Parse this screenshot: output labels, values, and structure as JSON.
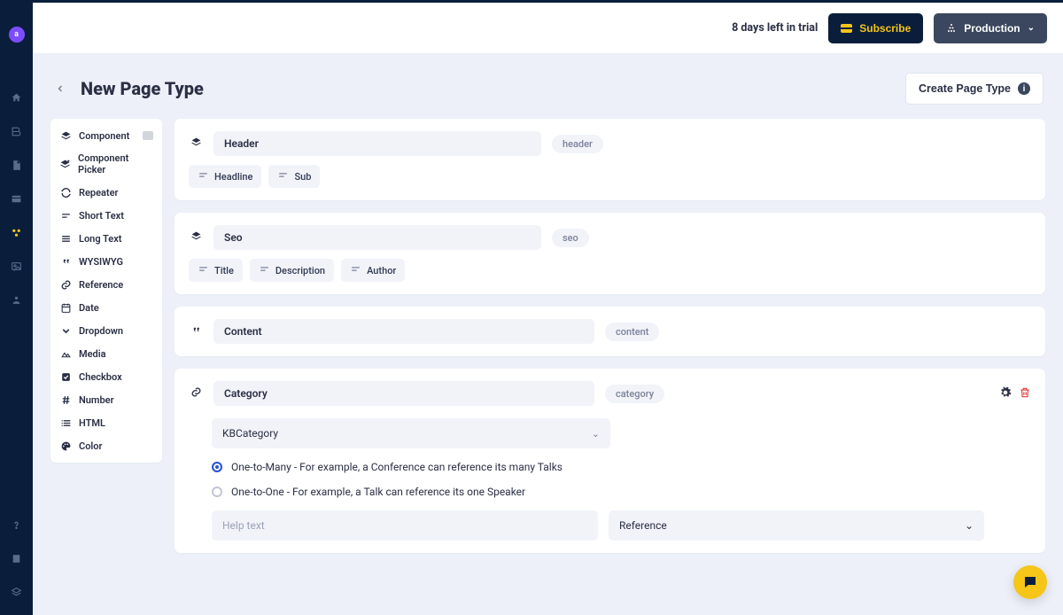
{
  "header": {
    "trial_text": "8 days left in trial",
    "subscribe_label": "Subscribe",
    "env_label": "Production"
  },
  "page": {
    "title": "New Page Type",
    "create_label": "Create Page Type"
  },
  "sidebar": {
    "avatar_letter": "a"
  },
  "palette": [
    {
      "icon": "layers",
      "label": "Component",
      "tail": true
    },
    {
      "icon": "layers-plus",
      "label": "Component Picker"
    },
    {
      "icon": "refresh",
      "label": "Repeater"
    },
    {
      "icon": "short",
      "label": "Short Text"
    },
    {
      "icon": "long",
      "label": "Long Text"
    },
    {
      "icon": "quote",
      "label": "WYSIWYG"
    },
    {
      "icon": "link",
      "label": "Reference"
    },
    {
      "icon": "date",
      "label": "Date"
    },
    {
      "icon": "chev",
      "label": "Dropdown"
    },
    {
      "icon": "media",
      "label": "Media"
    },
    {
      "icon": "check",
      "label": "Checkbox"
    },
    {
      "icon": "hash",
      "label": "Number"
    },
    {
      "icon": "list",
      "label": "HTML"
    },
    {
      "icon": "color",
      "label": "Color"
    }
  ],
  "components": [
    {
      "type": "component",
      "type_icon": "layers",
      "name": "Header",
      "slug": "header",
      "children": [
        {
          "icon": "short",
          "label": "Headline"
        },
        {
          "icon": "short",
          "label": "Sub"
        }
      ]
    },
    {
      "type": "component",
      "type_icon": "layers",
      "name": "Seo",
      "slug": "seo",
      "children": [
        {
          "icon": "short",
          "label": "Title"
        },
        {
          "icon": "short",
          "label": "Description"
        },
        {
          "icon": "short",
          "label": "Author"
        }
      ]
    },
    {
      "type": "wysiwyg",
      "type_icon": "quote",
      "name": "Content",
      "slug": "content",
      "name_wide": true
    },
    {
      "type": "reference",
      "type_icon": "link",
      "name": "Category",
      "slug": "category",
      "name_wide": true,
      "expanded": true,
      "ref": {
        "model": "KBCategory",
        "options": [
          {
            "value": "many",
            "label": "One-to-Many - For example, a Conference can reference its many Talks",
            "selected": true
          },
          {
            "value": "one",
            "label": "One-to-One - For example, a Talk can reference its one Speaker",
            "selected": false
          }
        ],
        "help_placeholder": "Help text",
        "field_type": "Reference"
      }
    }
  ]
}
